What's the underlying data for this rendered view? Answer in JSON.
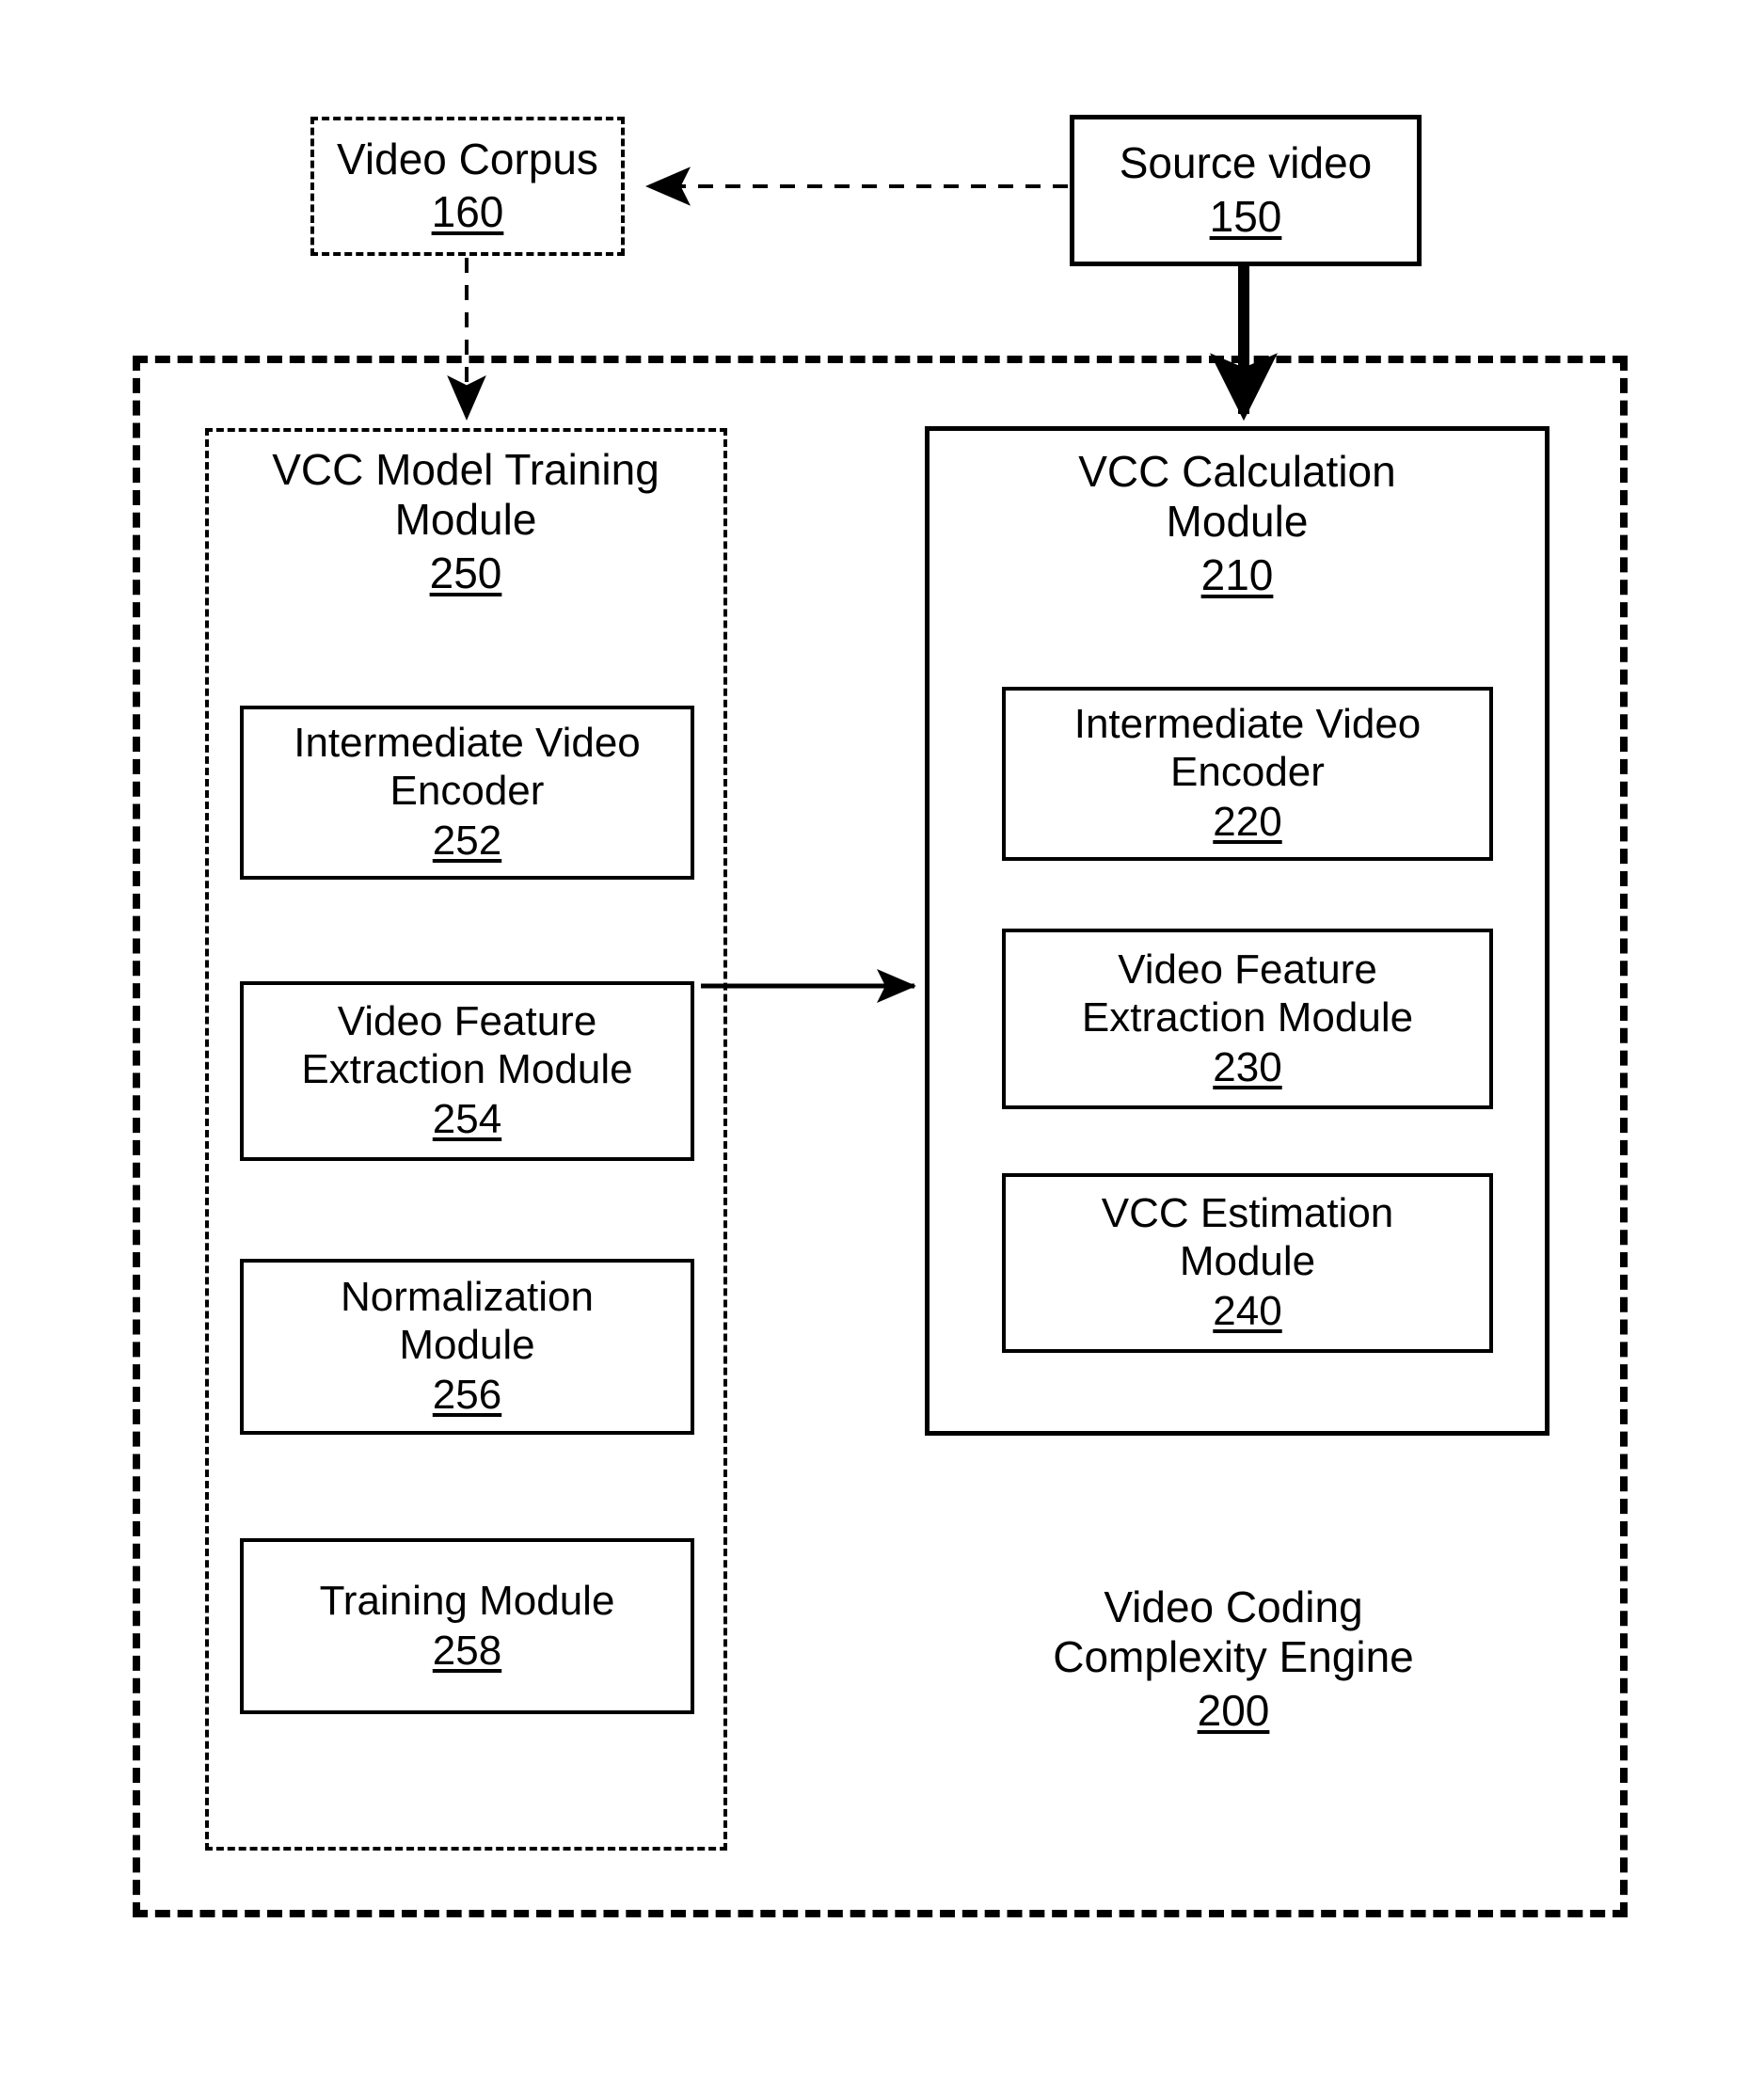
{
  "figure": {
    "kind": "patent-block-diagram",
    "background_color": "#ffffff",
    "stroke_color": "#000000"
  },
  "nodes": {
    "video_corpus": {
      "label": "Video Corpus",
      "ref": "160",
      "border": "dashed"
    },
    "source_video": {
      "label": "Source video",
      "ref": "150",
      "border": "solid"
    },
    "engine": {
      "label": "Video Coding\nComplexity Engine",
      "ref": "200",
      "border": "dashed"
    },
    "training_module": {
      "label": "VCC Model Training\nModule",
      "ref": "250",
      "border": "dashed",
      "children": [
        {
          "label": "Intermediate Video\nEncoder",
          "ref": "252"
        },
        {
          "label": "Video Feature\nExtraction Module",
          "ref": "254"
        },
        {
          "label": "Normalization\nModule",
          "ref": "256"
        },
        {
          "label": "Training Module",
          "ref": "258"
        }
      ]
    },
    "calculation_module": {
      "label": "VCC Calculation\nModule",
      "ref": "210",
      "border": "solid",
      "children": [
        {
          "label": "Intermediate Video\nEncoder",
          "ref": "220"
        },
        {
          "label": "Video Feature\nExtraction Module",
          "ref": "230"
        },
        {
          "label": "VCC Estimation\nModule",
          "ref": "240"
        }
      ]
    }
  },
  "connections": [
    {
      "name": "source-video-to-video-corpus",
      "style": "dashed-thin",
      "direction": "right-to-left"
    },
    {
      "name": "video-corpus-to-training-module",
      "style": "dashed-thin",
      "direction": "top-to-bottom"
    },
    {
      "name": "source-video-to-calculation-module",
      "style": "solid-thick",
      "direction": "top-to-bottom"
    },
    {
      "name": "training-module-to-calculation-module",
      "style": "solid-thin",
      "direction": "left-to-right"
    }
  ]
}
